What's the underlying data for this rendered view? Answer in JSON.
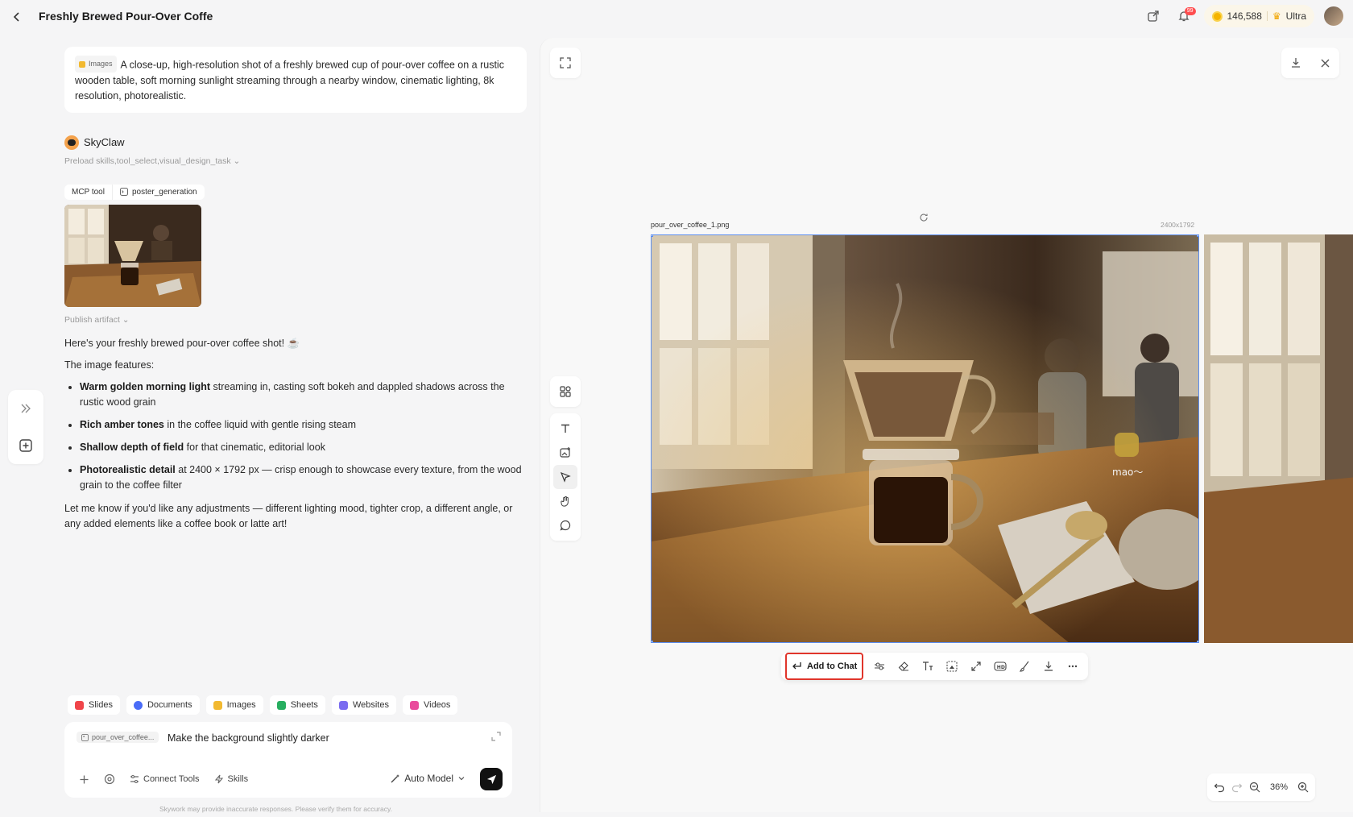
{
  "header": {
    "title": "Freshly Brewed Pour-Over Coffe",
    "notification_count": "99",
    "credits": "146,588",
    "plan": "Ultra"
  },
  "chat": {
    "prompt_tag": "Images",
    "prompt_text": "A close-up, high-resolution shot of a freshly brewed cup of pour-over coffee on a rustic wooden table, soft morning sunlight streaming through a nearby window, cinematic lighting, 8k resolution, photorealistic.",
    "agent_name": "SkyClaw",
    "preload": "Preload skills,tool_select,visual_design_task",
    "tool_label": "MCP tool",
    "tool_name": "poster_generation",
    "publish": "Publish artifact",
    "reply_intro": "Here's your freshly brewed pour-over coffee shot! ☕",
    "features_heading": "The image features:",
    "features": [
      {
        "bold": "Warm golden morning light",
        "rest": " streaming in, casting soft bokeh and dappled shadows across the rustic wood grain"
      },
      {
        "bold": "Rich amber tones",
        "rest": " in the coffee liquid with gentle rising steam"
      },
      {
        "bold": "Shallow depth of field",
        "rest": " for that cinematic, editorial look"
      },
      {
        "bold": "Photorealistic detail",
        "rest": " at 2400 × 1792 px — crisp enough to showcase every texture, from the wood grain to the coffee filter"
      }
    ],
    "closing": "Let me know if you'd like any adjustments — different lighting mood, tighter crop, a different angle, or any added elements like a coffee book or latte art!"
  },
  "quick_chips": [
    {
      "label": "Slides",
      "color": "#f0454a"
    },
    {
      "label": "Documents",
      "color": "#4a6cf7"
    },
    {
      "label": "Images",
      "color": "#f2b930"
    },
    {
      "label": "Sheets",
      "color": "#27ae60"
    },
    {
      "label": "Websites",
      "color": "#7a6cf0"
    },
    {
      "label": "Videos",
      "color": "#e94b9c"
    }
  ],
  "composer": {
    "ref_file": "pour_over_coffee...",
    "text": "Make the background slightly darker",
    "connect_tools": "Connect Tools",
    "skills": "Skills",
    "model": "Auto Model",
    "disclaimer": "Skywork may provide inaccurate responses. Please verify them for accuracy."
  },
  "canvas": {
    "file_name": "pour_over_coffee_1.png",
    "dimensions": "2400x1792",
    "watermark": "mao～",
    "add_to_chat": "Add to Chat",
    "zoom": "36%"
  }
}
